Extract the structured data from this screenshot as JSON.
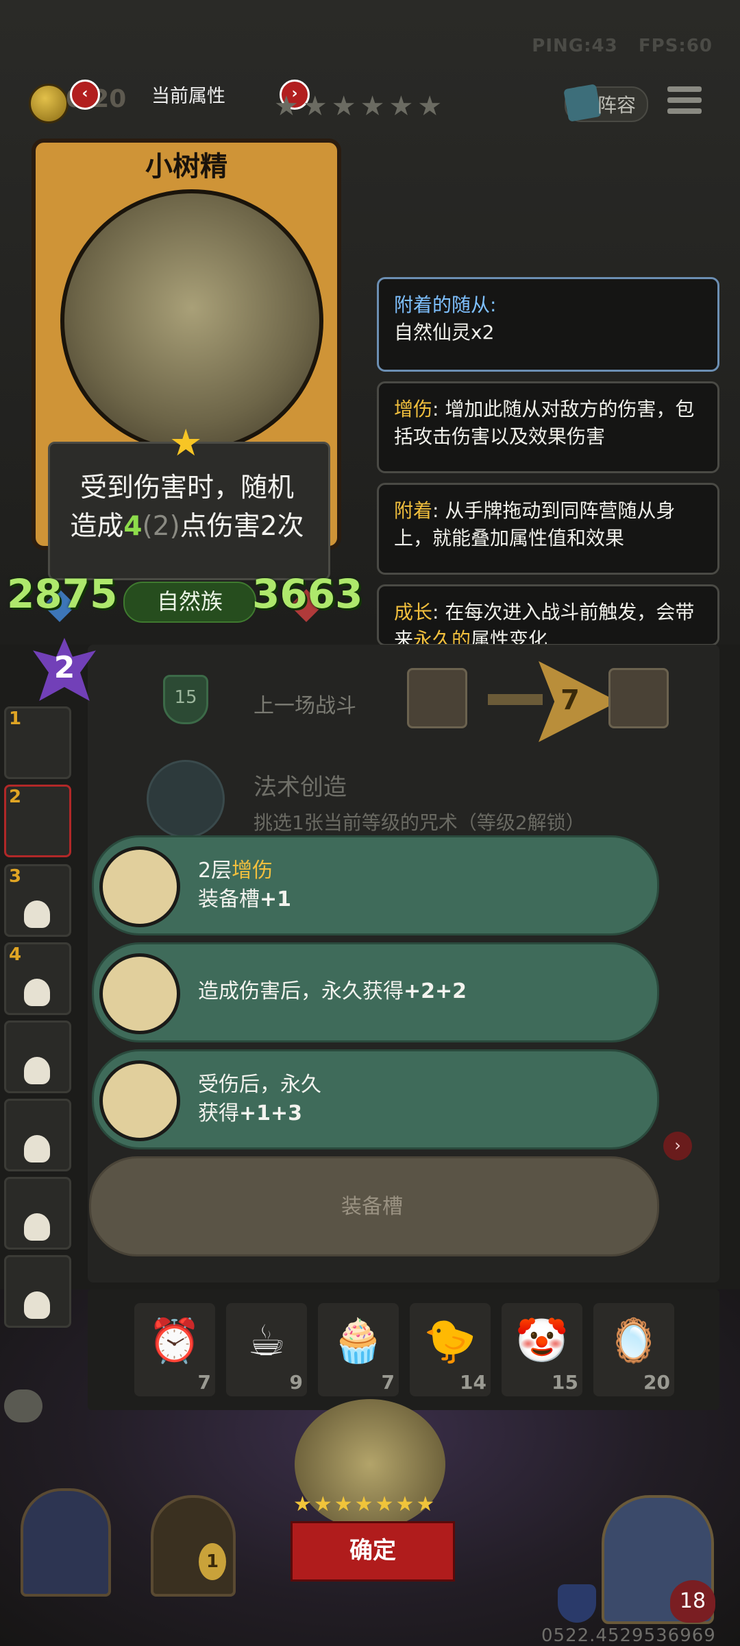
{
  "hud": {
    "ping": "PING:43",
    "fps": "FPS:60"
  },
  "top": {
    "coin_count": "0/20",
    "tab_title": "当前属性",
    "prev": "‹",
    "next": "›",
    "stars": "★★★★★★",
    "lineup_label": "阵容"
  },
  "card": {
    "name": "小树精",
    "desc_line1": "受到伤害时，随机",
    "desc_prefix": "造成",
    "desc_value": "4",
    "desc_paren": "(2)",
    "desc_suffix": "点伤害2次",
    "attack": "2875",
    "health": "3663",
    "tribe": "自然族"
  },
  "info_boxes": [
    {
      "title": "附着的随从:",
      "body": "自然仙灵x2"
    },
    {
      "keyword": "增伤",
      "body": ": 增加此随从对敌方的伤害，包括攻击伤害以及效果伤害"
    },
    {
      "keyword": "附着",
      "body": ": 从手牌拖动到同阵营随从身上，就能叠加属性值和效果"
    },
    {
      "keyword": "成长",
      "body_a": ": 在每次进入战斗前触发，会带来",
      "highlight": "永久的",
      "body_b": "属性变化"
    }
  ],
  "panel": {
    "mana": "2",
    "shield_level": "15",
    "last_fight": "上一场战斗",
    "arrow_value": "7",
    "spell_title": "法术创造",
    "spell_desc": "挑选1张当前等级的咒术（等级2解锁）"
  },
  "options": [
    {
      "line1_prefix": "2层",
      "line1_keyword": "增伤",
      "line2_prefix": "装备槽",
      "line2_value": "+1"
    },
    {
      "line1_prefix": "造成伤害后，永久获得",
      "line1_value": "+2+2"
    },
    {
      "line1_prefix": "受伤后，永久",
      "line2_prefix": "获得",
      "line2_value": "+1+3"
    }
  ],
  "slot_button": "装备槽",
  "roster": [
    "1",
    "2",
    "3",
    "4"
  ],
  "items": [
    {
      "icon": "alarm-clock-icon",
      "glyph": "⏰",
      "count": "7"
    },
    {
      "icon": "teacup-icon",
      "glyph": "☕",
      "count": "9"
    },
    {
      "icon": "cupcake-icon",
      "glyph": "🧁",
      "count": "7"
    },
    {
      "icon": "bird-icon",
      "glyph": "🐤",
      "count": "14"
    },
    {
      "icon": "clown-icon",
      "glyph": "🤡",
      "count": "15"
    },
    {
      "icon": "mirror-icon",
      "glyph": "🪞",
      "count": "20"
    }
  ],
  "bottom": {
    "confirm": "确定",
    "stars": "★★★★★★★",
    "coin_value": "1",
    "hp": "18",
    "seed": "0522.4529536969"
  },
  "colors": {
    "green_value": "#8ddc4b",
    "keyword_yellow": "#f1bf3d",
    "keyword_blue": "#7ec0ff",
    "option_bg": "#3f6b5a",
    "confirm_red": "#b01c1c"
  }
}
